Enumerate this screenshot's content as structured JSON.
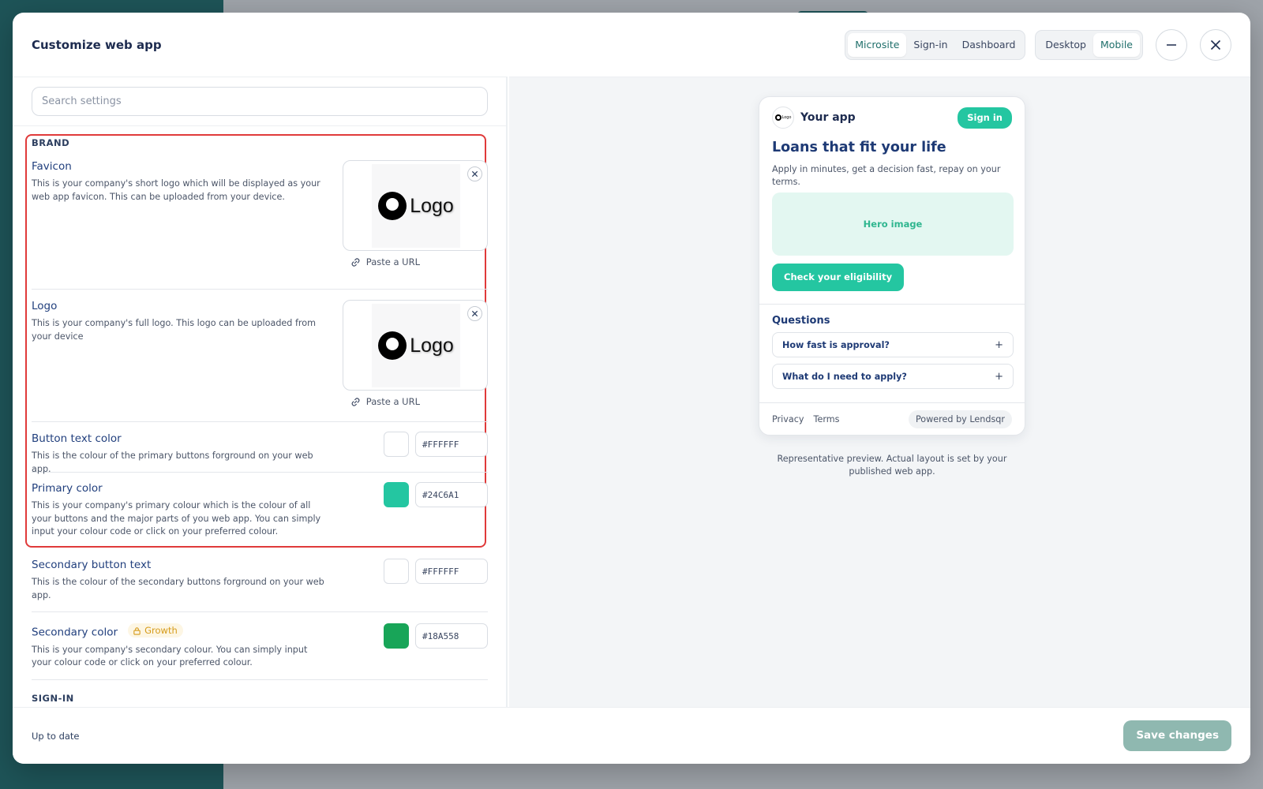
{
  "modal": {
    "title": "Customize web app"
  },
  "view_tabs": [
    {
      "label": "Microsite",
      "active": true
    },
    {
      "label": "Sign-in",
      "active": false
    },
    {
      "label": "Dashboard",
      "active": false
    }
  ],
  "device_tabs": [
    {
      "label": "Desktop",
      "active": false
    },
    {
      "label": "Mobile",
      "active": true
    }
  ],
  "search": {
    "placeholder": "Search settings",
    "value": ""
  },
  "brand": {
    "section_title": "BRAND",
    "favicon": {
      "label": "Favicon",
      "description": "This is your company's short logo which will be displayed as your web app favicon. This can be uploaded from your device.",
      "image_text": "Logo",
      "paste_url": "Paste a URL"
    },
    "logo": {
      "label": "Logo",
      "description": "This is your company's full logo. This logo can be uploaded from your device",
      "image_text": "Logo",
      "paste_url": "Paste a URL"
    },
    "button_text_color": {
      "label": "Button text color",
      "description": "This is the colour of the primary buttons forground on your web app.",
      "value": "#FFFFFF"
    },
    "primary_color": {
      "label": "Primary color",
      "description": "This is your company's primary colour which is the colour of all your buttons and the major parts of you web app. You can simply input your colour code or click on your preferred colour.",
      "value": "#24C6A1"
    },
    "secondary_button_text": {
      "label": "Secondary button text",
      "description": "This is the colour of the secondary buttons forground on your web app.",
      "value": "#FFFFFF"
    },
    "secondary_color": {
      "label": "Secondary color",
      "badge": "Growth",
      "description": "This is your company's secondary colour. You can simply input your colour code or click on your preferred colour.",
      "value": "#18A558"
    }
  },
  "signin_section": {
    "section_title": "SIGN-IN"
  },
  "preview": {
    "logo_text": "Logo",
    "app_name": "Your app",
    "signin_label": "Sign in",
    "headline": "Loans that fit your life",
    "subtext": "Apply in minutes, get a decision fast, repay on your terms.",
    "hero_label": "Hero image",
    "cta_label": "Check your eligibility",
    "questions_title": "Questions",
    "questions": [
      {
        "text": "How fast is approval?",
        "icon": "+"
      },
      {
        "text": "What do I need to apply?",
        "icon": "+"
      }
    ],
    "footer_links": [
      "Privacy",
      "Terms"
    ],
    "powered_by": "Powered by Lendsqr",
    "note": "Representative preview. Actual layout is set by your published web app."
  },
  "footer": {
    "status": "Up to date",
    "save_label": "Save changes"
  },
  "colors": {
    "accent": "#24C6A1",
    "secondary": "#18A558",
    "save_disabled": "#8FB8B0",
    "highlight": "#E03A3A"
  }
}
